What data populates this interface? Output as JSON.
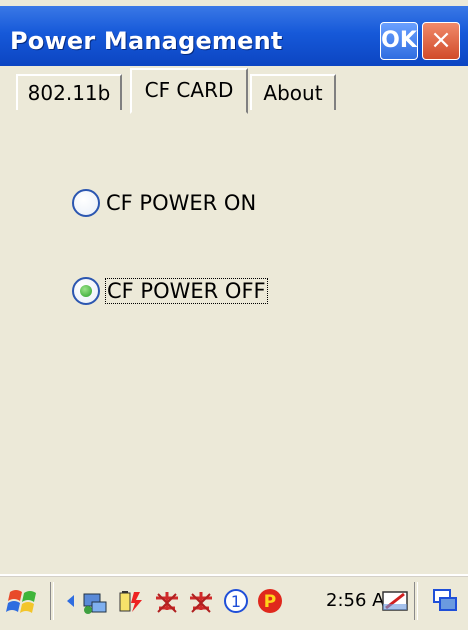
{
  "window": {
    "title": "Power Management",
    "ok_label": "OK",
    "close_label": "×"
  },
  "tabs": [
    {
      "label": "802.11b",
      "active": false
    },
    {
      "label": "CF CARD",
      "active": true
    },
    {
      "label": "About",
      "active": false
    }
  ],
  "options": [
    {
      "label": "CF POWER ON",
      "selected": false
    },
    {
      "label": "CF POWER OFF",
      "selected": true
    }
  ],
  "taskbar": {
    "start_icon": "windows-flag-icon",
    "tray_icons": [
      "arrow-left-icon",
      "network-icon",
      "battery-icon",
      "bluetooth-off-icon",
      "wireless-off-icon",
      "number-one-icon",
      "p-icon"
    ],
    "clock": "2:56 AM",
    "end_icons": [
      "input-panel-icon",
      "desktop-icon"
    ]
  },
  "colors": {
    "title_bar": "#1659d9",
    "background": "#ece9d8",
    "ok_button": "#2f6de0",
    "close_button": "#d14b2a",
    "radio_selected": "#28a028"
  }
}
